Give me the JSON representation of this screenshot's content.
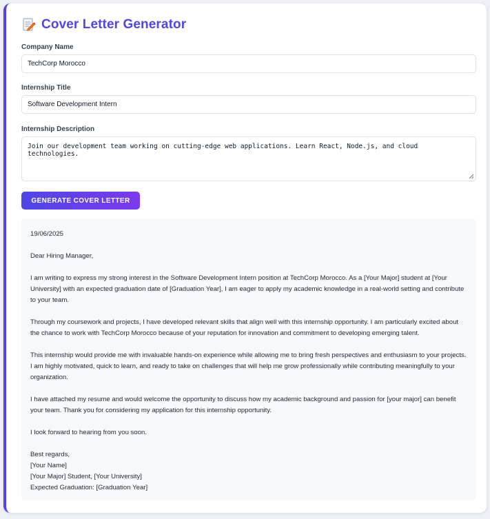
{
  "header": {
    "title": "Cover Letter Generator",
    "icon": "memo-icon"
  },
  "form": {
    "company_label": "Company Name",
    "company_value": "TechCorp Morocco",
    "title_label": "Internship Title",
    "title_value": "Software Development Intern",
    "description_label": "Internship Description",
    "description_value": "Join our development team working on cutting-edge web applications. Learn React, Node.js, and cloud technologies.",
    "generate_label": "GENERATE COVER LETTER"
  },
  "letter": {
    "date": "19/06/2025",
    "greeting": "Dear Hiring Manager,",
    "paragraphs": [
      "I am writing to express my strong interest in the Software Development Intern position at TechCorp Morocco. As a [Your Major] student at [Your University] with an expected graduation date of [Graduation Year], I am eager to apply my academic knowledge in a real-world setting and contribute to your team.",
      "Through my coursework and projects, I have developed relevant skills that align well with this internship opportunity. I am particularly excited about the chance to work with TechCorp Morocco because of your reputation for innovation and commitment to developing emerging talent.",
      "This internship would provide me with invaluable hands-on experience while allowing me to bring fresh perspectives and enthusiasm to your projects. I am highly motivated, quick to learn, and ready to take on challenges that will help me grow professionally while contributing meaningfully to your organization.",
      "I have attached my resume and would welcome the opportunity to discuss how my academic background and passion for [your major] can benefit your team. Thank you for considering my application for this internship opportunity.",
      "I look forward to hearing from you soon."
    ],
    "closing": "Best regards,",
    "signature_lines": [
      "[Your Name]",
      "[Your Major] Student, [Your University]",
      "Expected Graduation: [Graduation Year]"
    ]
  },
  "colors": {
    "accent": "#5046e5",
    "button_gradient_start": "#4f46e5",
    "button_gradient_end": "#7c3aed",
    "output_background": "#f7f8fa"
  }
}
